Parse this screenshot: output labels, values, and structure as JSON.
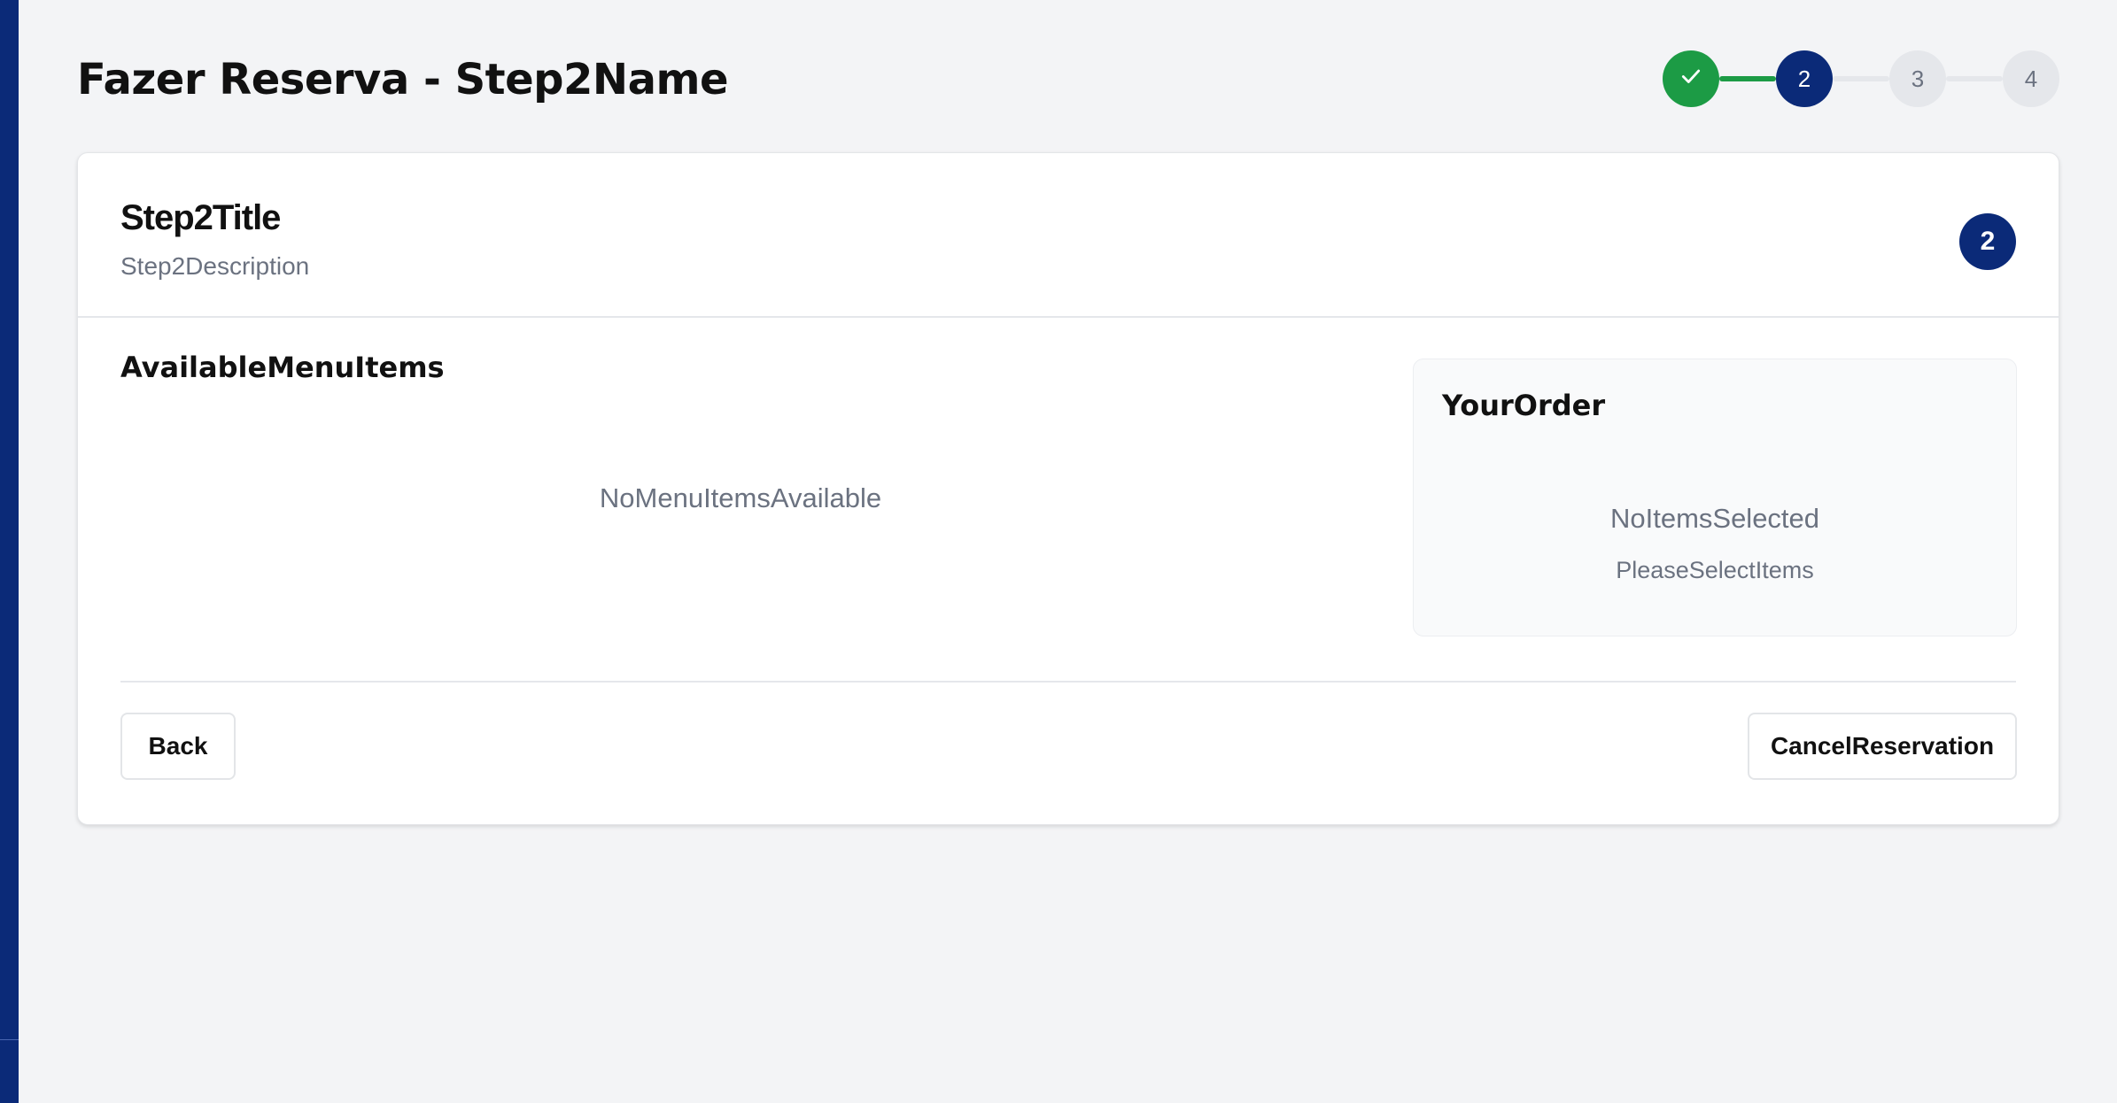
{
  "page": {
    "title": "Fazer Reserva - Step2Name"
  },
  "stepper": {
    "steps": [
      {
        "label": "",
        "state": "complete",
        "icon": "check-icon"
      },
      {
        "label": "2",
        "state": "active"
      },
      {
        "label": "3",
        "state": "pending"
      },
      {
        "label": "4",
        "state": "pending"
      }
    ]
  },
  "card": {
    "title": "Step2Title",
    "description": "Step2Description",
    "step_badge": "2"
  },
  "menu": {
    "heading": "AvailableMenuItems",
    "empty_text": "NoMenuItemsAvailable"
  },
  "order": {
    "heading": "YourOrder",
    "empty_text": "NoItemsSelected",
    "hint_text": "PleaseSelectItems"
  },
  "actions": {
    "back_label": "Back",
    "cancel_label": "CancelReservation"
  },
  "colors": {
    "primary": "#0b2a78",
    "success": "#1c9b45",
    "muted_text": "#6b7280",
    "background": "#f3f4f6"
  }
}
